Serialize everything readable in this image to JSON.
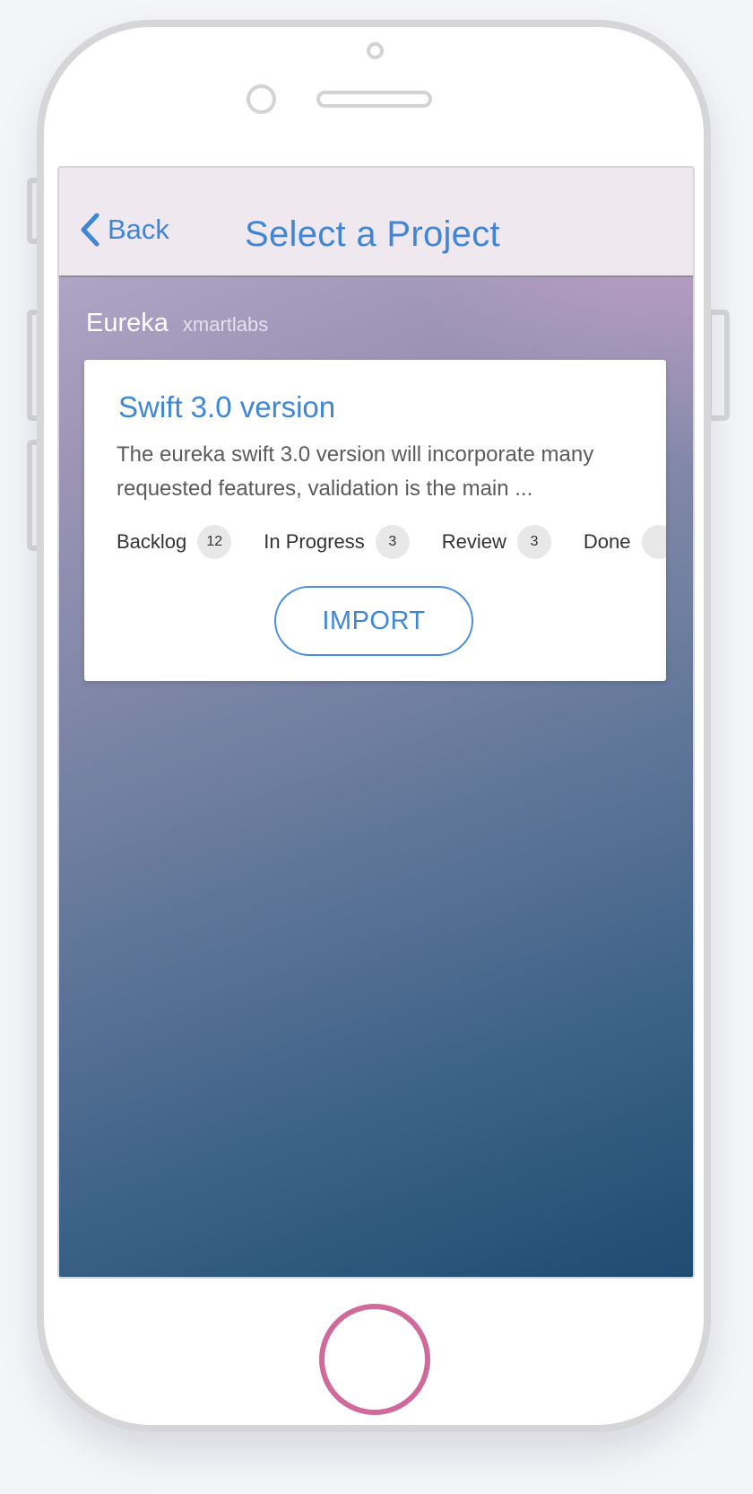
{
  "navbar": {
    "back_label": "Back",
    "title": "Select a Project"
  },
  "organization": {
    "name": "Eureka",
    "owner": "xmartlabs"
  },
  "project": {
    "title": "Swift 3.0 version",
    "description": "The eureka swift 3.0 version will incorporate many requested features, validation is the main ...",
    "stats": [
      {
        "label": "Backlog",
        "count": "12"
      },
      {
        "label": "In Progress",
        "count": "3"
      },
      {
        "label": "Review",
        "count": "3"
      },
      {
        "label": "Done",
        "count": ""
      }
    ],
    "import_label": "IMPORT"
  },
  "colors": {
    "accent": "#3f86d6",
    "home_button": "#d06a9b",
    "navbar_bg": "#f0e8ef",
    "gradient_top": "#b7aed0",
    "gradient_bottom": "#1f4c72"
  },
  "icons": {
    "back": "chevron-left-icon"
  }
}
